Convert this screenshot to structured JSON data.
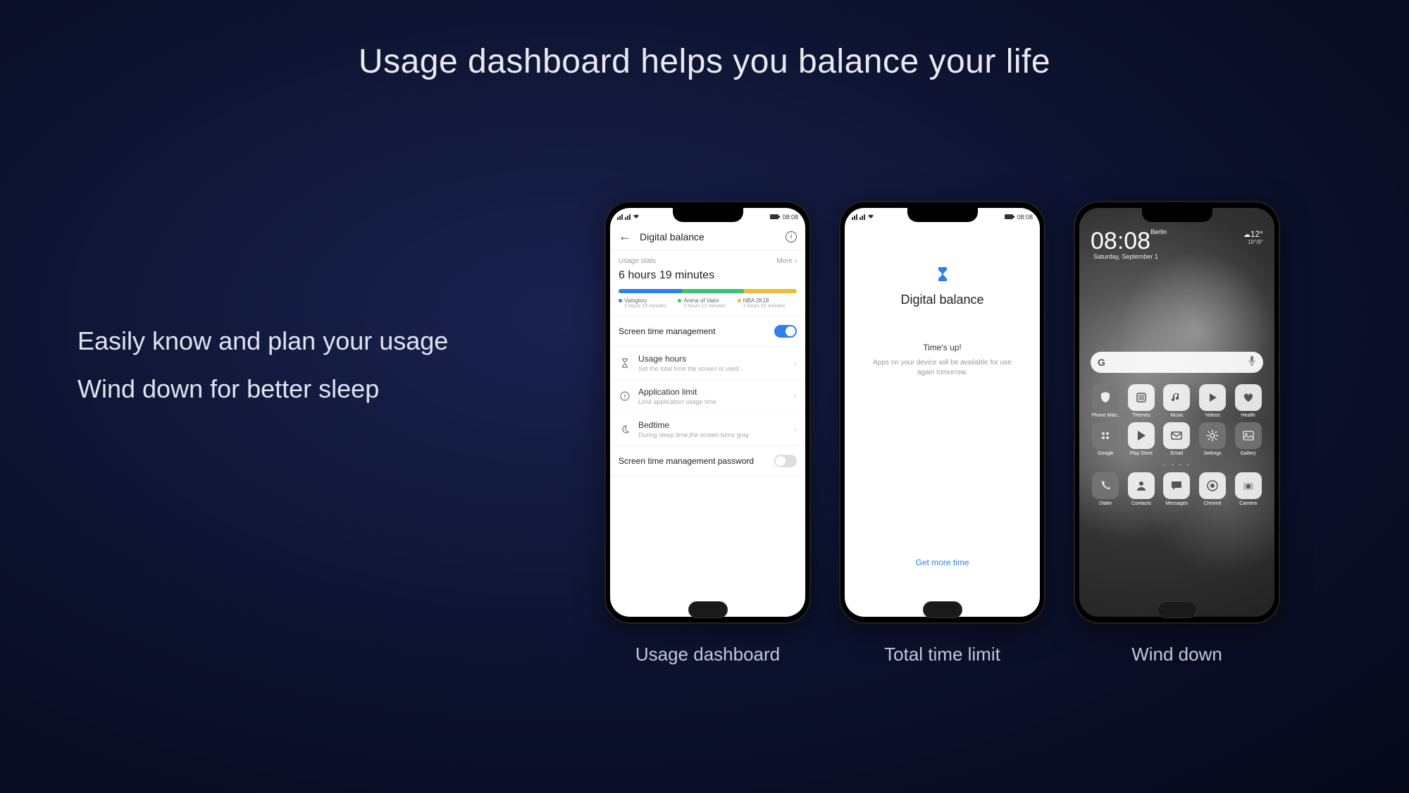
{
  "slide": {
    "title": "Usage dashboard helps you balance your life",
    "tagline1": "Easily know and plan your usage",
    "tagline2": "Wind down for better sleep"
  },
  "captions": {
    "phone1": "Usage dashboard",
    "phone2": "Total time limit",
    "phone3": "Wind down"
  },
  "statusbar": {
    "time": "08:08"
  },
  "phone1": {
    "header_title": "Digital balance",
    "stats_label": "Usage stats",
    "more": "More",
    "total_time": "6 hours 19 minutes",
    "legend": [
      {
        "name": "Vainglory",
        "time": "2 hours 15 minutes",
        "color": "#2f7fef"
      },
      {
        "name": "Arena of Valor",
        "time": "2 hours 12 minutes",
        "color": "#3fc26e"
      },
      {
        "name": "NBA 2K18",
        "time": "1 hours 52 minutes",
        "color": "#f0b93a"
      }
    ],
    "stm_label": "Screen time management",
    "items": [
      {
        "title": "Usage hours",
        "sub": "Set the total time the screen is used"
      },
      {
        "title": "Application limit",
        "sub": "Limit application usage time"
      },
      {
        "title": "Bedtime",
        "sub": "During sleep time,the screen turns gray"
      }
    ],
    "password_label": "Screen time management password"
  },
  "phone2": {
    "title": "Digital balance",
    "timesup": "Time's up!",
    "desc": "Apps on your device will be available for use again tomorrow.",
    "link": "Get more time"
  },
  "phone3": {
    "clock": "08:08",
    "city": "Berlin",
    "date": "Saturday, September 1",
    "temp": "12°",
    "temp_range": "18°/8°",
    "search_g": "G",
    "apps_row1": [
      "Phone Man..",
      "Themes",
      "Music",
      "Videos",
      "Health"
    ],
    "apps_row2": [
      "Google",
      "Play Store",
      "Email",
      "Settings",
      "Gallery"
    ],
    "dock": [
      "Dialer",
      "Contacts",
      "Messages",
      "Chrome",
      "Camera"
    ]
  },
  "chart_data": {
    "type": "bar",
    "title": "Usage stats",
    "total": "6 hours 19 minutes",
    "series": [
      {
        "name": "Vainglory",
        "value_label": "2 hours 15 minutes",
        "minutes": 135,
        "color": "#2f7fef"
      },
      {
        "name": "Arena of Valor",
        "value_label": "2 hours 12 minutes",
        "minutes": 132,
        "color": "#3fc26e"
      },
      {
        "name": "NBA 2K18",
        "value_label": "1 hours 52 minutes",
        "minutes": 112,
        "color": "#f0b93a"
      }
    ]
  }
}
